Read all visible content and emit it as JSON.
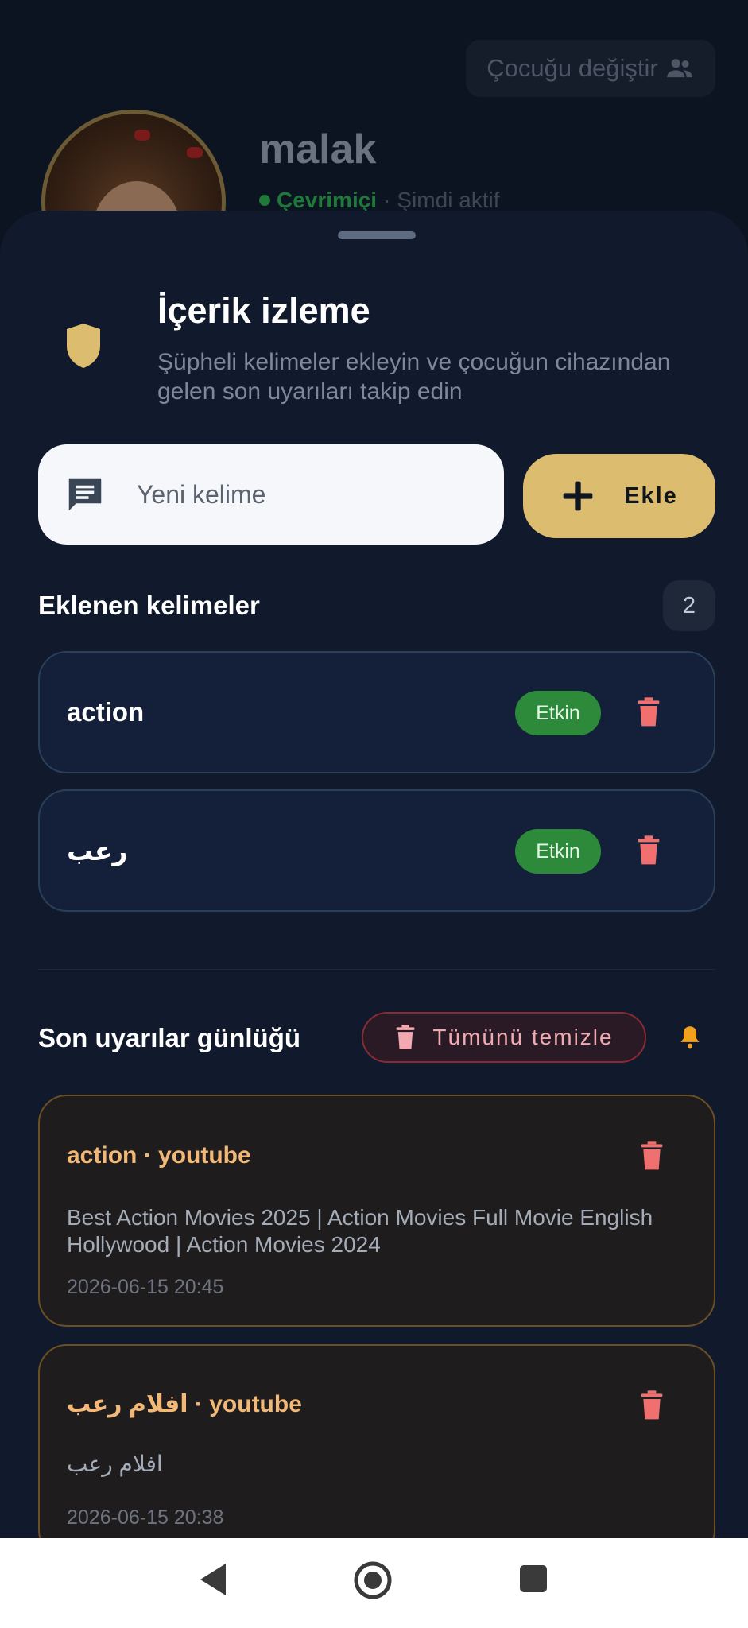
{
  "header": {
    "switch_child_label": "Çocuğu değiştir",
    "child_name": "malak",
    "status_online": "Çevrimiçi",
    "status_separator": "·",
    "status_active": "Şimdi aktif"
  },
  "monitoring": {
    "title": "İçerik izleme",
    "subtitle": "Şüpheli kelimeler ekleyin ve çocuğun cihazından gelen son uyarıları takip edin",
    "input_placeholder": "Yeni kelime",
    "input_value": "",
    "add_label": "Ekle"
  },
  "words": {
    "section_title": "Eklenen kelimeler",
    "count": "2",
    "items": [
      {
        "word": "action",
        "status": "Etkin"
      },
      {
        "word": "رعب",
        "status": "Etkin"
      }
    ]
  },
  "alerts": {
    "section_title": "Son uyarılar günlüğü",
    "clear_label": "Tümünü temizle",
    "items": [
      {
        "keyword": "action",
        "separator": " · ",
        "source": "youtube",
        "text": "Best Action Movies 2025 | Action Movies Full Movie English Hollywood | Action Movies 2024",
        "time": "2026-06-15 20:45"
      },
      {
        "keyword": "افلام رعب",
        "separator": " · ",
        "source": "youtube",
        "text": "افلام رعب",
        "time": "2026-06-15 20:38"
      }
    ]
  },
  "colors": {
    "accent": "#dcbc6e",
    "active_pill": "#2d8a3a",
    "danger": "#f07070",
    "alert_orange": "#f1b878"
  }
}
